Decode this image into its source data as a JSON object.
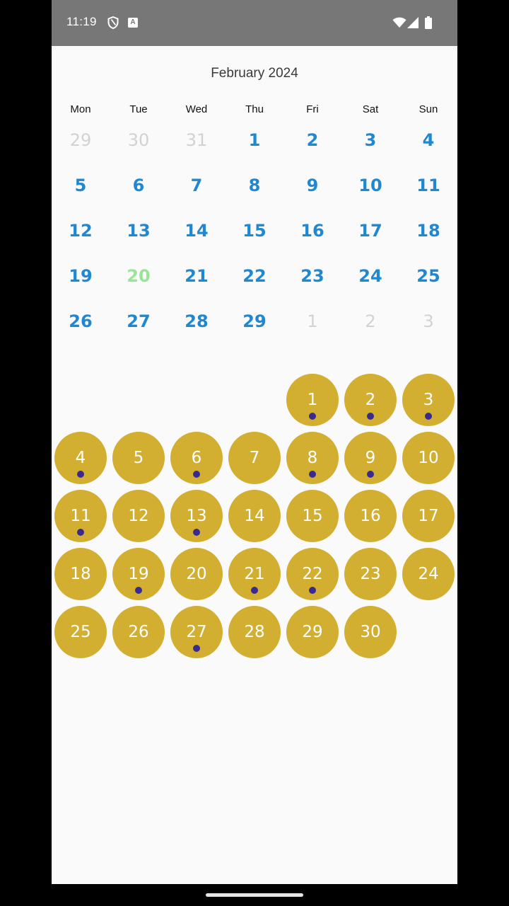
{
  "status_bar": {
    "time": "11:19",
    "a_icon_letter": "A"
  },
  "calendar": {
    "title": "February 2024",
    "weekdays": [
      "Mon",
      "Tue",
      "Wed",
      "Thu",
      "Fri",
      "Sat",
      "Sun"
    ],
    "days": [
      {
        "n": "29",
        "state": "out"
      },
      {
        "n": "30",
        "state": "out"
      },
      {
        "n": "31",
        "state": "out"
      },
      {
        "n": "1",
        "state": "in"
      },
      {
        "n": "2",
        "state": "in"
      },
      {
        "n": "3",
        "state": "in"
      },
      {
        "n": "4",
        "state": "in"
      },
      {
        "n": "5",
        "state": "in"
      },
      {
        "n": "6",
        "state": "in"
      },
      {
        "n": "7",
        "state": "in"
      },
      {
        "n": "8",
        "state": "in"
      },
      {
        "n": "9",
        "state": "in"
      },
      {
        "n": "10",
        "state": "in"
      },
      {
        "n": "11",
        "state": "in"
      },
      {
        "n": "12",
        "state": "in"
      },
      {
        "n": "13",
        "state": "in"
      },
      {
        "n": "14",
        "state": "in"
      },
      {
        "n": "15",
        "state": "in"
      },
      {
        "n": "16",
        "state": "in"
      },
      {
        "n": "17",
        "state": "in"
      },
      {
        "n": "18",
        "state": "in"
      },
      {
        "n": "19",
        "state": "in"
      },
      {
        "n": "20",
        "state": "today"
      },
      {
        "n": "21",
        "state": "in"
      },
      {
        "n": "22",
        "state": "in"
      },
      {
        "n": "23",
        "state": "in"
      },
      {
        "n": "24",
        "state": "in"
      },
      {
        "n": "25",
        "state": "in"
      },
      {
        "n": "26",
        "state": "in"
      },
      {
        "n": "27",
        "state": "in"
      },
      {
        "n": "28",
        "state": "in"
      },
      {
        "n": "29",
        "state": "in"
      },
      {
        "n": "1",
        "state": "out"
      },
      {
        "n": "2",
        "state": "out"
      },
      {
        "n": "3",
        "state": "out"
      }
    ]
  },
  "bubble_grid": {
    "leading_blank_cells": 4,
    "days": [
      {
        "n": "1",
        "dot": true
      },
      {
        "n": "2",
        "dot": true
      },
      {
        "n": "3",
        "dot": true
      },
      {
        "n": "4",
        "dot": true
      },
      {
        "n": "5",
        "dot": false
      },
      {
        "n": "6",
        "dot": true
      },
      {
        "n": "7",
        "dot": false
      },
      {
        "n": "8",
        "dot": true
      },
      {
        "n": "9",
        "dot": true
      },
      {
        "n": "10",
        "dot": false
      },
      {
        "n": "11",
        "dot": true
      },
      {
        "n": "12",
        "dot": false
      },
      {
        "n": "13",
        "dot": true
      },
      {
        "n": "14",
        "dot": false
      },
      {
        "n": "15",
        "dot": false
      },
      {
        "n": "16",
        "dot": false
      },
      {
        "n": "17",
        "dot": false
      },
      {
        "n": "18",
        "dot": false
      },
      {
        "n": "19",
        "dot": true
      },
      {
        "n": "20",
        "dot": false
      },
      {
        "n": "21",
        "dot": true
      },
      {
        "n": "22",
        "dot": true
      },
      {
        "n": "23",
        "dot": false
      },
      {
        "n": "24",
        "dot": false
      },
      {
        "n": "25",
        "dot": false
      },
      {
        "n": "26",
        "dot": false
      },
      {
        "n": "27",
        "dot": true
      },
      {
        "n": "28",
        "dot": false
      },
      {
        "n": "29",
        "dot": false
      },
      {
        "n": "30",
        "dot": false
      }
    ]
  },
  "colors": {
    "day_in_month": "#1f88d0",
    "day_out_month": "#d2d2d2",
    "day_today": "#98e596",
    "bubble": "#d2ae31",
    "dot": "#3a2a8f",
    "status_bar": "#777777"
  }
}
